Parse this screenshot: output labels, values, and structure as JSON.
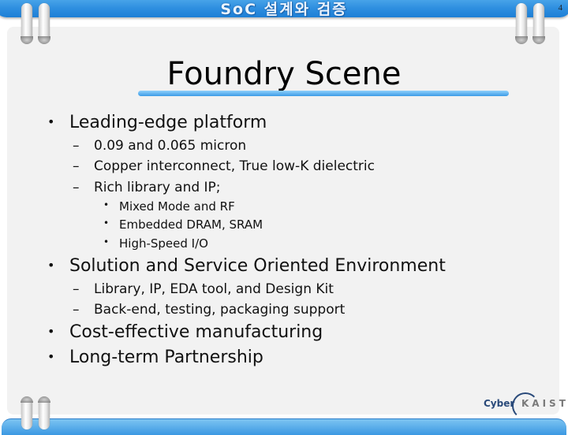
{
  "header": {
    "title": "SoC 설계와 검증",
    "page_number": "4"
  },
  "slide": {
    "title": "Foundry Scene",
    "bullets": [
      {
        "text": "Leading-edge platform",
        "sub": [
          {
            "text": "0.09 and 0.065 micron"
          },
          {
            "text": "Copper interconnect, True low-K dielectric"
          },
          {
            "text": "Rich library and IP;",
            "sub": [
              {
                "text": "Mixed Mode and RF"
              },
              {
                "text": "Embedded DRAM, SRAM"
              },
              {
                "text": "High-Speed I/O"
              }
            ]
          }
        ]
      },
      {
        "text": "Solution and Service Oriented Environment",
        "sub": [
          {
            "text": "Library, IP, EDA tool, and Design Kit"
          },
          {
            "text": "Back-end, testing, packaging support"
          }
        ]
      },
      {
        "text": "Cost-effective manufacturing"
      },
      {
        "text": "Long-term Partnership"
      }
    ]
  },
  "markers": {
    "bullet": "•",
    "dash": "–"
  },
  "logo": {
    "cyber": "Cyber",
    "kaist": "KAIST"
  },
  "colors": {
    "header_blue": "#2f8fe0",
    "underline_blue": "#3d9ce6",
    "panel_gray": "#f2f2f2"
  }
}
